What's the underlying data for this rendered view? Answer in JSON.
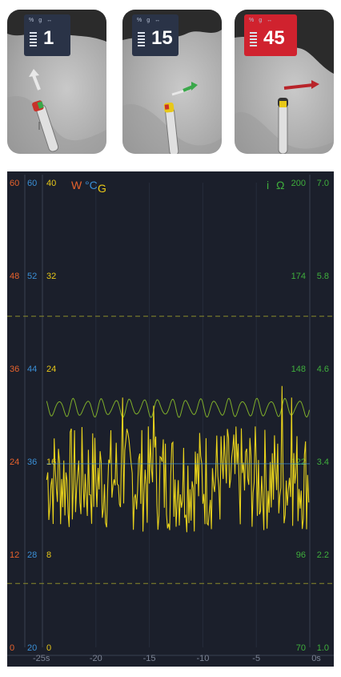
{
  "contact_panels": [
    {
      "units": [
        "%",
        "g",
        "↔"
      ],
      "value": "1",
      "badge_color": "#2a3347",
      "arrow_color": "#e8e8e8"
    },
    {
      "units": [
        "%",
        "g",
        "↔"
      ],
      "value": "15",
      "badge_color": "#2a3347",
      "arrow_color": "#3aa84a"
    },
    {
      "units": [
        "%",
        "g",
        "↔"
      ],
      "value": "45",
      "badge_color": "#d0222e",
      "arrow_color": "#b8242a"
    }
  ],
  "chart_data": {
    "type": "line",
    "background": "#1b1f2b",
    "legend_left": {
      "W": "W",
      "degC": "°C",
      "G": "G"
    },
    "legend_right": {
      "i": "i",
      "ohm": "Ω"
    },
    "axes": {
      "W": {
        "color": "#e8622c",
        "ticks": [
          "60",
          "48",
          "36",
          "24",
          "12",
          "0"
        ],
        "range": [
          0,
          60
        ]
      },
      "degC": {
        "color": "#3a8fd6",
        "ticks": [
          "60",
          "52",
          "44",
          "36",
          "28",
          "20"
        ],
        "range": [
          20,
          60
        ]
      },
      "G": {
        "color": "#e8c818",
        "ticks": [
          "40",
          "32",
          "24",
          "16",
          "8",
          "0"
        ],
        "range": [
          0,
          40
        ]
      },
      "ohm": {
        "color": "#3fae3c",
        "ticks": [
          "200",
          "174",
          "148",
          "122",
          "96",
          "70"
        ],
        "range": [
          70,
          200
        ]
      },
      "i": {
        "color": "#3fae3c",
        "ticks": [
          "7.0",
          "5.8",
          "4.6",
          "3.4",
          "2.2",
          "1.0"
        ],
        "range": [
          1.0,
          7.0
        ]
      }
    },
    "x_ticks": [
      "-25s",
      "-20",
      "-15",
      "-10",
      "-5",
      "0s"
    ],
    "x_range": [
      -25,
      0
    ],
    "dashed_levels_G": [
      28.5,
      5.5
    ],
    "series": [
      {
        "axis": "ohm",
        "color": "#7fae2a",
        "kind": "sine",
        "mean": 137,
        "amplitude": 2.2,
        "period_s": 1.32
      },
      {
        "axis": "G",
        "color": "#e8d21c",
        "kind": "noise",
        "mean": 14.5,
        "amplitude": 4.6,
        "peaks": [
          [
            -17.5,
            21.5
          ],
          [
            -14.6,
            20.8
          ],
          [
            -2.6,
            22.5
          ],
          [
            -1.7,
            21.5
          ]
        ]
      },
      {
        "axis": "degC",
        "color": "#3a8fd6",
        "kind": "flat",
        "value": 35.8
      }
    ]
  }
}
